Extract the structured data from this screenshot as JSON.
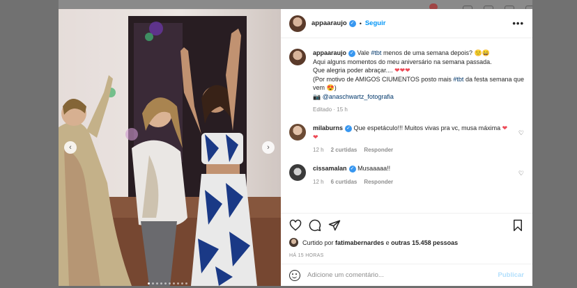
{
  "post": {
    "username": "appaaraujo",
    "follow_label": "Seguir",
    "more_label": "•••",
    "caption": {
      "part1": "Vale",
      "hashtag1": "#tbt",
      "part2": "menos de uma semana depois? 🙂😄",
      "line2": "Aqui alguns momentos do meu aniversário na semana passada.",
      "line3": "Que alegria poder abraçar....",
      "hearts": "❤❤❤",
      "line4a": "(Por motivo de AMIGOS CIUMENTOS posto mais",
      "hashtag2": "#tbt",
      "line4b": "da festa semana que vem 😍)",
      "camera": "📷",
      "mention": "@anaschwartz_fotografia"
    },
    "caption_meta": "Editado · 15 h"
  },
  "comments": [
    {
      "username": "milaburns",
      "text": "Que espetáculo!!! Muitos vivas pra vc, musa máxima",
      "hearts": "❤❤",
      "time": "12 h",
      "likes": "2 curtidas",
      "reply": "Responder"
    },
    {
      "username": "cissamalan",
      "text": "Musaaaaa!!",
      "hearts": "",
      "time": "12 h",
      "likes": "6 curtidas",
      "reply": "Responder"
    }
  ],
  "likes": {
    "prefix": "Curtido por",
    "user": "fatimabernardes",
    "middle": "e",
    "others": "outras 15.458 pessoas"
  },
  "timestamp": "HÁ 15 HORAS",
  "add_comment": {
    "placeholder": "Adicione um comentário...",
    "publish_label": "Publicar"
  },
  "carousel": {
    "total": 10,
    "active": 0,
    "prev_icon": "chevron-left-icon",
    "next_icon": "chevron-right-icon"
  },
  "colors": {
    "accent": "#0095f6",
    "verified": "#3897f0",
    "heart": "#ed4956",
    "link": "#00376b",
    "muted": "#8e8e8e",
    "overlay": "#6e6e6e"
  }
}
